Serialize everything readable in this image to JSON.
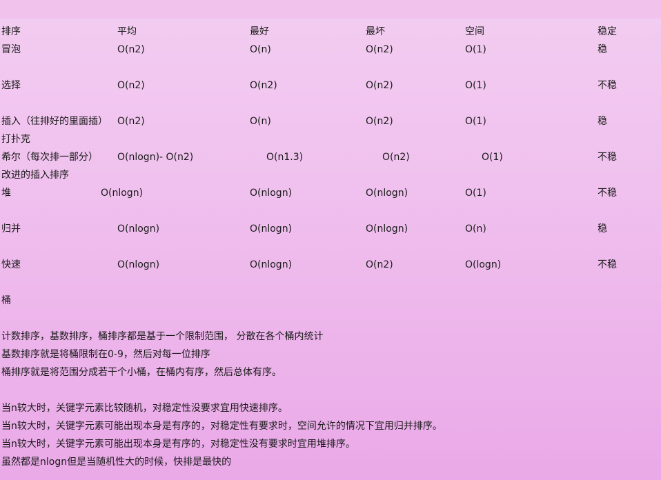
{
  "table": {
    "headers": [
      "排序",
      "平均",
      "最好",
      "最坏",
      "空间",
      "稳定"
    ],
    "rows": [
      {
        "name": "冒泡",
        "avg": "O(n2)",
        "best": "O(n)",
        "worst": "O(n2)",
        "space": "O(1)",
        "stable": "稳"
      },
      {
        "name": "选择",
        "avg": "O(n2)",
        "best": "O(n2)",
        "worst": "O(n2)",
        "space": "O(1)",
        "stable": "不稳"
      },
      {
        "name": "插入（往排好的里面插）",
        "avg": "O(n2)",
        "best": "O(n)",
        "worst": "O(n2)",
        "space": "O(1)",
        "stable": "稳"
      },
      {
        "name": "希尔（每次排一部分）",
        "avg": "O(nlogn)- O(n2)",
        "best": "O(n1.3)",
        "worst": "O(n2)",
        "space": "O(1)",
        "stable": "不稳"
      },
      {
        "name": "堆",
        "avg": "O(nlogn)",
        "best": "O(nlogn)",
        "worst": "O(nlogn)",
        "space": "O(1)",
        "stable": "不稳"
      },
      {
        "name": "归并",
        "avg": "O(nlogn)",
        "best": "O(nlogn)",
        "worst": "O(nlogn)",
        "space": "O(n)",
        "stable": "稳"
      },
      {
        "name": "快速",
        "avg": "O(nlogn)",
        "best": "O(nlogn)",
        "worst": "O(n2)",
        "space": "O(logn)",
        "stable": "不稳"
      }
    ],
    "notes": {
      "insert": "打扑克",
      "shell": "改进的插入排序"
    }
  },
  "bucket_title": "桶",
  "paragraph1": [
    "计数排序，基数排序，桶排序都是基于一个限制范围， 分散在各个桶内统计",
    "基数排序就是将桶限制在0-9，然后对每一位排序",
    "桶排序就是将范围分成若干个小桶，在桶内有序，然后总体有序。"
  ],
  "paragraph2": [
    "当n较大时，关键字元素比较随机，对稳定性没要求宜用快速排序。",
    "当n较大时，关键字元素可能出现本身是有序的，对稳定性有要求时，空间允许的情况下宜用归并排序。",
    "当n较大时，关键字元素可能出现本身是有序的，对稳定性没有要求时宜用堆排序。",
    "虽然都是nlogn但是当随机性大的时候，快排是最快的"
  ]
}
